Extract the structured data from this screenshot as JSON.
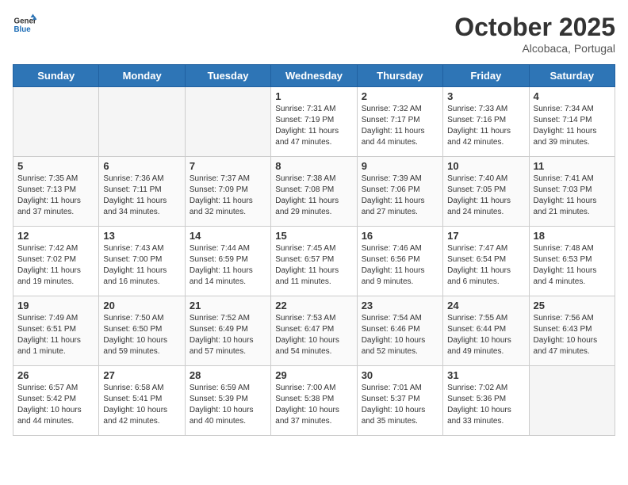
{
  "header": {
    "logo_line1": "General",
    "logo_line2": "Blue",
    "month": "October 2025",
    "location": "Alcobaca, Portugal"
  },
  "days_of_week": [
    "Sunday",
    "Monday",
    "Tuesday",
    "Wednesday",
    "Thursday",
    "Friday",
    "Saturday"
  ],
  "weeks": [
    [
      {
        "day": "",
        "info": ""
      },
      {
        "day": "",
        "info": ""
      },
      {
        "day": "",
        "info": ""
      },
      {
        "day": "1",
        "info": "Sunrise: 7:31 AM\nSunset: 7:19 PM\nDaylight: 11 hours\nand 47 minutes."
      },
      {
        "day": "2",
        "info": "Sunrise: 7:32 AM\nSunset: 7:17 PM\nDaylight: 11 hours\nand 44 minutes."
      },
      {
        "day": "3",
        "info": "Sunrise: 7:33 AM\nSunset: 7:16 PM\nDaylight: 11 hours\nand 42 minutes."
      },
      {
        "day": "4",
        "info": "Sunrise: 7:34 AM\nSunset: 7:14 PM\nDaylight: 11 hours\nand 39 minutes."
      }
    ],
    [
      {
        "day": "5",
        "info": "Sunrise: 7:35 AM\nSunset: 7:13 PM\nDaylight: 11 hours\nand 37 minutes."
      },
      {
        "day": "6",
        "info": "Sunrise: 7:36 AM\nSunset: 7:11 PM\nDaylight: 11 hours\nand 34 minutes."
      },
      {
        "day": "7",
        "info": "Sunrise: 7:37 AM\nSunset: 7:09 PM\nDaylight: 11 hours\nand 32 minutes."
      },
      {
        "day": "8",
        "info": "Sunrise: 7:38 AM\nSunset: 7:08 PM\nDaylight: 11 hours\nand 29 minutes."
      },
      {
        "day": "9",
        "info": "Sunrise: 7:39 AM\nSunset: 7:06 PM\nDaylight: 11 hours\nand 27 minutes."
      },
      {
        "day": "10",
        "info": "Sunrise: 7:40 AM\nSunset: 7:05 PM\nDaylight: 11 hours\nand 24 minutes."
      },
      {
        "day": "11",
        "info": "Sunrise: 7:41 AM\nSunset: 7:03 PM\nDaylight: 11 hours\nand 21 minutes."
      }
    ],
    [
      {
        "day": "12",
        "info": "Sunrise: 7:42 AM\nSunset: 7:02 PM\nDaylight: 11 hours\nand 19 minutes."
      },
      {
        "day": "13",
        "info": "Sunrise: 7:43 AM\nSunset: 7:00 PM\nDaylight: 11 hours\nand 16 minutes."
      },
      {
        "day": "14",
        "info": "Sunrise: 7:44 AM\nSunset: 6:59 PM\nDaylight: 11 hours\nand 14 minutes."
      },
      {
        "day": "15",
        "info": "Sunrise: 7:45 AM\nSunset: 6:57 PM\nDaylight: 11 hours\nand 11 minutes."
      },
      {
        "day": "16",
        "info": "Sunrise: 7:46 AM\nSunset: 6:56 PM\nDaylight: 11 hours\nand 9 minutes."
      },
      {
        "day": "17",
        "info": "Sunrise: 7:47 AM\nSunset: 6:54 PM\nDaylight: 11 hours\nand 6 minutes."
      },
      {
        "day": "18",
        "info": "Sunrise: 7:48 AM\nSunset: 6:53 PM\nDaylight: 11 hours\nand 4 minutes."
      }
    ],
    [
      {
        "day": "19",
        "info": "Sunrise: 7:49 AM\nSunset: 6:51 PM\nDaylight: 11 hours\nand 1 minute."
      },
      {
        "day": "20",
        "info": "Sunrise: 7:50 AM\nSunset: 6:50 PM\nDaylight: 10 hours\nand 59 minutes."
      },
      {
        "day": "21",
        "info": "Sunrise: 7:52 AM\nSunset: 6:49 PM\nDaylight: 10 hours\nand 57 minutes."
      },
      {
        "day": "22",
        "info": "Sunrise: 7:53 AM\nSunset: 6:47 PM\nDaylight: 10 hours\nand 54 minutes."
      },
      {
        "day": "23",
        "info": "Sunrise: 7:54 AM\nSunset: 6:46 PM\nDaylight: 10 hours\nand 52 minutes."
      },
      {
        "day": "24",
        "info": "Sunrise: 7:55 AM\nSunset: 6:44 PM\nDaylight: 10 hours\nand 49 minutes."
      },
      {
        "day": "25",
        "info": "Sunrise: 7:56 AM\nSunset: 6:43 PM\nDaylight: 10 hours\nand 47 minutes."
      }
    ],
    [
      {
        "day": "26",
        "info": "Sunrise: 6:57 AM\nSunset: 5:42 PM\nDaylight: 10 hours\nand 44 minutes."
      },
      {
        "day": "27",
        "info": "Sunrise: 6:58 AM\nSunset: 5:41 PM\nDaylight: 10 hours\nand 42 minutes."
      },
      {
        "day": "28",
        "info": "Sunrise: 6:59 AM\nSunset: 5:39 PM\nDaylight: 10 hours\nand 40 minutes."
      },
      {
        "day": "29",
        "info": "Sunrise: 7:00 AM\nSunset: 5:38 PM\nDaylight: 10 hours\nand 37 minutes."
      },
      {
        "day": "30",
        "info": "Sunrise: 7:01 AM\nSunset: 5:37 PM\nDaylight: 10 hours\nand 35 minutes."
      },
      {
        "day": "31",
        "info": "Sunrise: 7:02 AM\nSunset: 5:36 PM\nDaylight: 10 hours\nand 33 minutes."
      },
      {
        "day": "",
        "info": ""
      }
    ]
  ]
}
